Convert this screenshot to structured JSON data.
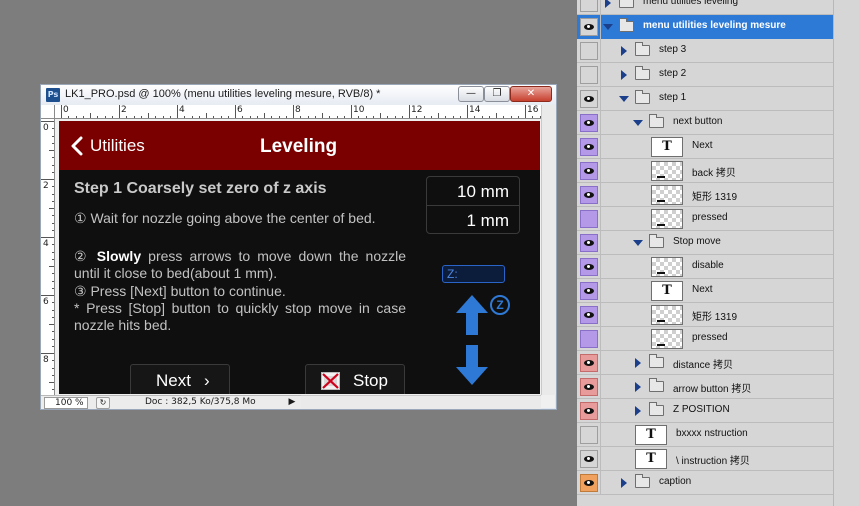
{
  "document_window": {
    "title": "LK1_PRO.psd @ 100% (menu utilities leveling mesure, RVB/8) *",
    "app_icon": "photoshop-icon",
    "controls": {
      "minimize": "minimize-icon",
      "restore": "restore-icon",
      "close": "close-icon"
    },
    "ruler_h": [
      "0",
      "2",
      "4",
      "6",
      "8",
      "10",
      "12",
      "14",
      "16"
    ],
    "ruler_v": [
      "0",
      "2",
      "4",
      "6",
      "8"
    ],
    "status": {
      "zoom": "100 %",
      "doc_info": "Doc : 382,5 Ko/375,8 Mo"
    }
  },
  "device_screen": {
    "header": {
      "back_label": "Utilities",
      "title": "Leveling"
    },
    "step_title": "Step 1 Coarsely set zero of z axis",
    "instructions": {
      "line1": "① Wait for nozzle going above the center of bed.",
      "line2_bold": "Slowly",
      "line2_pre": "②",
      "line2_rest": "press arrows to move down the nozzle until it  close to bed(about 1 mm).",
      "line3": "③ Press [Next] button to continue.",
      "line4": "* Press [Stop] button to quickly stop move in case nozzle hits bed."
    },
    "distances": [
      "10 mm",
      "1 mm"
    ],
    "z_position_label": "Z:",
    "z_badge": "Z",
    "buttons": {
      "next": "Next",
      "next_chevron": "›",
      "stop": "Stop"
    },
    "colors": {
      "header": "#7a0000",
      "accent_blue": "#2f79d6",
      "background": "#0f0f0f"
    }
  },
  "layers_panel": {
    "layers": [
      {
        "name": "menu utilities leveling",
        "kind": "group",
        "level": 0,
        "state": "collapsed",
        "eye": "none"
      },
      {
        "name": "menu utilities leveling mesure",
        "kind": "group",
        "level": 0,
        "state": "expanded",
        "eye": "visible",
        "selected": true
      },
      {
        "name": "step 3",
        "kind": "group",
        "level": 1,
        "state": "collapsed",
        "eye": "none"
      },
      {
        "name": "step 2",
        "kind": "group",
        "level": 1,
        "state": "collapsed",
        "eye": "none"
      },
      {
        "name": "step 1",
        "kind": "group",
        "level": 1,
        "state": "expanded",
        "eye": "visible"
      },
      {
        "name": "next button",
        "kind": "group",
        "level": 2,
        "state": "expanded",
        "eye": "violet"
      },
      {
        "name": "Next",
        "kind": "text",
        "level": 3,
        "eye": "violet"
      },
      {
        "name": "back 拷贝",
        "kind": "pixel",
        "level": 3,
        "eye": "violet"
      },
      {
        "name": "矩形 1319",
        "kind": "pixel",
        "level": 3,
        "eye": "violet"
      },
      {
        "name": "pressed",
        "kind": "pixel",
        "level": 3,
        "eye": "violet-hidden"
      },
      {
        "name": "Stop move",
        "kind": "group",
        "level": 2,
        "state": "expanded",
        "eye": "violet"
      },
      {
        "name": "disable",
        "kind": "pixel",
        "level": 3,
        "eye": "violet"
      },
      {
        "name": "Next",
        "kind": "text",
        "level": 3,
        "eye": "violet"
      },
      {
        "name": "矩形 1319",
        "kind": "pixel",
        "level": 3,
        "eye": "violet"
      },
      {
        "name": "pressed",
        "kind": "pixel",
        "level": 3,
        "eye": "violet-hidden"
      },
      {
        "name": "distance 拷贝",
        "kind": "group",
        "level": 2,
        "state": "collapsed",
        "eye": "red"
      },
      {
        "name": "arrow button 拷贝",
        "kind": "group",
        "level": 2,
        "state": "collapsed",
        "eye": "red"
      },
      {
        "name": "Z POSITION",
        "kind": "group",
        "level": 2,
        "state": "collapsed",
        "eye": "red"
      },
      {
        "name": "bxxxx nstruction",
        "kind": "text",
        "level": 2,
        "eye": "none"
      },
      {
        "name": "\\ instruction 拷贝",
        "kind": "text",
        "level": 2,
        "eye": "visible"
      },
      {
        "name": "caption",
        "kind": "group",
        "level": 1,
        "state": "collapsed",
        "eye": "orange"
      }
    ]
  }
}
